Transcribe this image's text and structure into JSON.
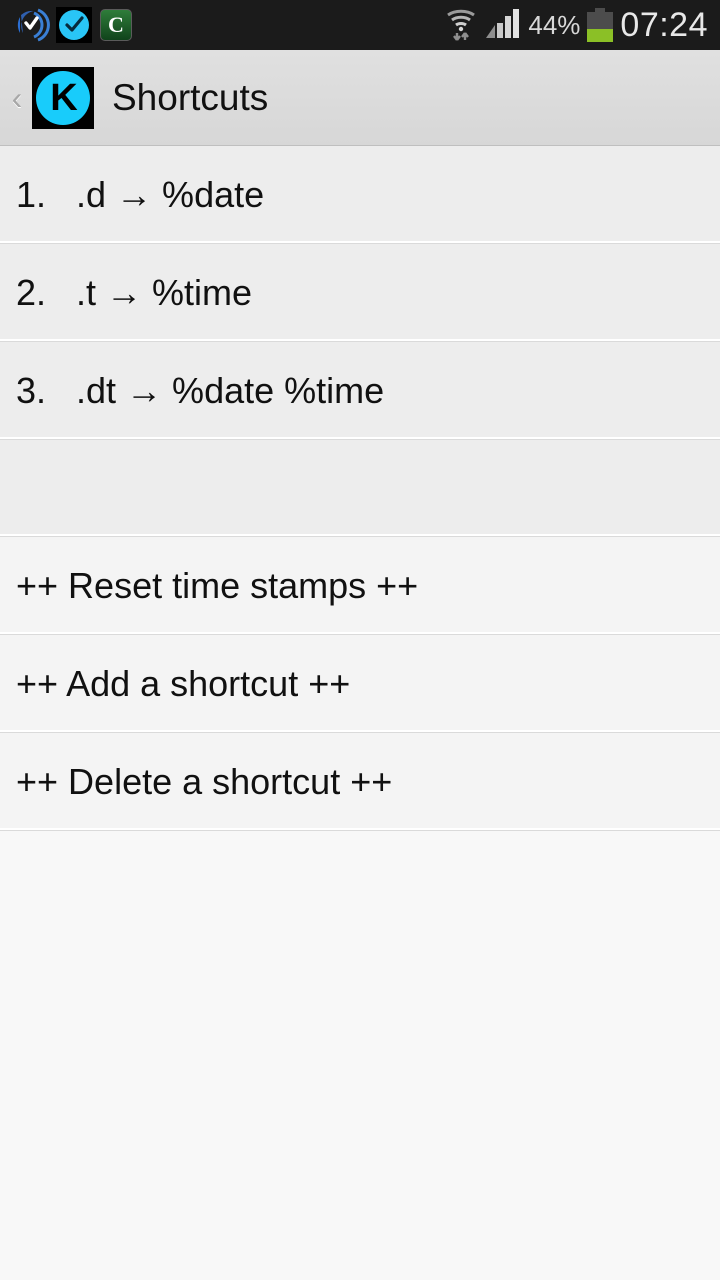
{
  "status_bar": {
    "notification_icons": [
      {
        "name": "wireless-sync-icon",
        "label": "wireless"
      },
      {
        "name": "clock-check-icon",
        "label": "check"
      },
      {
        "name": "green-c-app-icon",
        "label": "C"
      }
    ],
    "wifi_icon": "wifi-transfer-icon",
    "signal_icon": "cellular-signal-icon",
    "battery_percent": "44%",
    "battery_level": 44,
    "clock": "07:24"
  },
  "action_bar": {
    "back_label": "‹",
    "app_icon_letter": "K",
    "title": "Shortcuts"
  },
  "list": {
    "shortcuts": [
      {
        "index": "1.",
        "trigger": ".d",
        "arrow": "→",
        "expansion": "%date",
        "text": "1.   .d → %date"
      },
      {
        "index": "2.",
        "trigger": ".t",
        "arrow": "→",
        "expansion": "%time",
        "text": "2.   .t → %time"
      },
      {
        "index": "3.",
        "trigger": ".dt",
        "arrow": "→",
        "expansion": "%date %time",
        "text": "3.   .dt → %date %time"
      }
    ],
    "empty_row": "",
    "actions": [
      {
        "text": "++ Reset time stamps ++"
      },
      {
        "text": "++ Add a shortcut ++"
      },
      {
        "text": "++ Delete a shortcut ++"
      }
    ]
  },
  "colors": {
    "statusbar_bg": "#1b1b1b",
    "actionbar_bg": "#dcdcdc",
    "accent_cyan": "#18ccfb",
    "battery_green": "#8bc026",
    "row_bg": "#ededed",
    "action_row_bg": "#f4f4f4",
    "page_bg": "#f8f8f8"
  }
}
